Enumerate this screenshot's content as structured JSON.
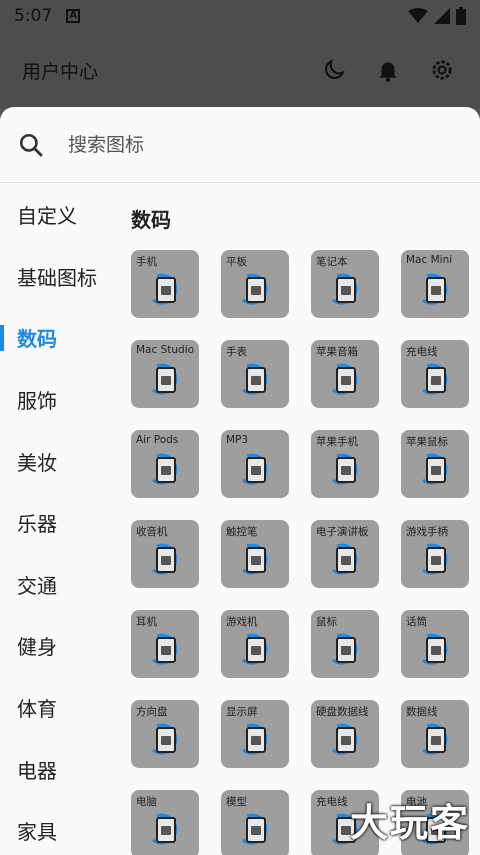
{
  "status": {
    "time": "5:07",
    "a_badge": "A"
  },
  "appbar": {
    "title": "用户中心",
    "icons": [
      "moon-icon",
      "bell-icon",
      "gear-icon"
    ]
  },
  "search": {
    "placeholder": "搜索图标"
  },
  "sidebar": {
    "items": [
      {
        "label": "自定义"
      },
      {
        "label": "基础图标"
      },
      {
        "label": "数码"
      },
      {
        "label": "服饰"
      },
      {
        "label": "美妆"
      },
      {
        "label": "乐器"
      },
      {
        "label": "交通"
      },
      {
        "label": "健身"
      },
      {
        "label": "体育"
      },
      {
        "label": "电器"
      },
      {
        "label": "家具"
      }
    ],
    "active_index": 2
  },
  "section": {
    "title": "数码"
  },
  "tiles": [
    {
      "label": "手机"
    },
    {
      "label": "平板"
    },
    {
      "label": "笔记本"
    },
    {
      "label": "Mac Mini"
    },
    {
      "label": "Mac Studio"
    },
    {
      "label": "手表"
    },
    {
      "label": "苹果音箱"
    },
    {
      "label": "充电线"
    },
    {
      "label": "Air Pods"
    },
    {
      "label": "MP3"
    },
    {
      "label": "苹果手机"
    },
    {
      "label": "苹果鼠标"
    },
    {
      "label": "收音机"
    },
    {
      "label": "触控笔"
    },
    {
      "label": "电子演讲板"
    },
    {
      "label": "游戏手柄"
    },
    {
      "label": "耳机"
    },
    {
      "label": "游戏机"
    },
    {
      "label": "鼠标"
    },
    {
      "label": "话筒"
    },
    {
      "label": "方向盘"
    },
    {
      "label": "显示屏"
    },
    {
      "label": "硬盘数据线"
    },
    {
      "label": "数据线"
    },
    {
      "label": "电脑"
    },
    {
      "label": "模型"
    },
    {
      "label": "充电线"
    },
    {
      "label": "电池"
    }
  ],
  "watermark": "大玩客"
}
